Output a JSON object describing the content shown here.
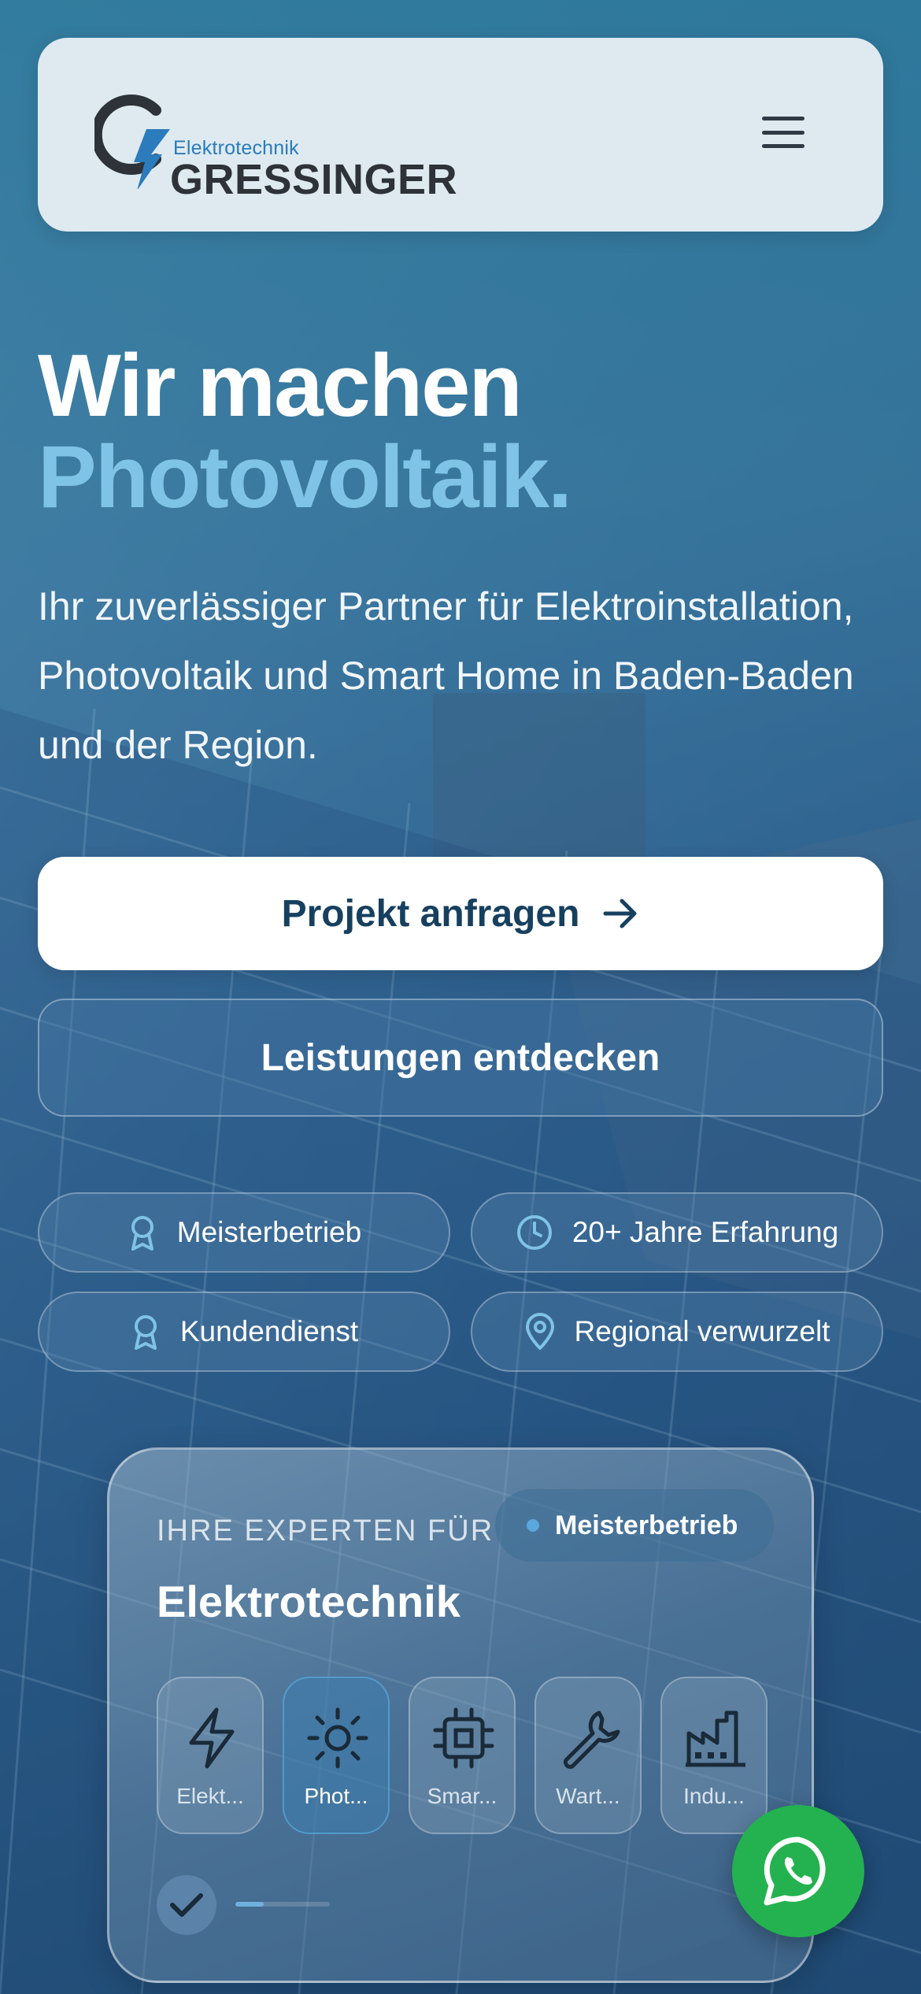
{
  "header": {
    "logo_small": "Elektrotechnik",
    "logo_big": "GRESSINGER",
    "menu_icon": "hamburger-menu-icon"
  },
  "hero": {
    "title_line1": "Wir machen",
    "title_line2": "Photovoltaik.",
    "subtitle": "Ihr zuverlässiger Partner für Elektroinstallation, Photovoltaik und Smart Home in Baden-Baden und der Region.",
    "primary_button": "Projekt anfragen",
    "secondary_button": "Leistungen entdecken"
  },
  "badges": [
    {
      "label": "Meisterbetrieb",
      "icon": "award-icon"
    },
    {
      "label": "20+ Jahre Erfahrung",
      "icon": "clock-icon"
    },
    {
      "label": "Kundendienst",
      "icon": "award-icon"
    },
    {
      "label": "Regional verwurzelt",
      "icon": "map-pin-icon"
    }
  ],
  "card": {
    "kicker": "IHRE EXPERTEN FÜR",
    "pill": "Meisterbetrieb",
    "title": "Elektrotechnik",
    "tiles": [
      {
        "label": "Elekt...",
        "icon": "lightning-icon",
        "active": false
      },
      {
        "label": "Phot...",
        "icon": "sun-icon",
        "active": true
      },
      {
        "label": "Smar...",
        "icon": "chip-icon",
        "active": false
      },
      {
        "label": "Wart...",
        "icon": "wrench-icon",
        "active": false
      },
      {
        "label": "Indu...",
        "icon": "factory-icon",
        "active": false
      }
    ],
    "progress": 0.3
  },
  "floating": {
    "whatsapp_icon": "whatsapp-icon"
  },
  "colors": {
    "accent_light_blue": "#7fc3e6",
    "primary_text_dark": "#17405f",
    "whatsapp_green": "#23b24f",
    "logo_blue": "#2b7bbd"
  }
}
